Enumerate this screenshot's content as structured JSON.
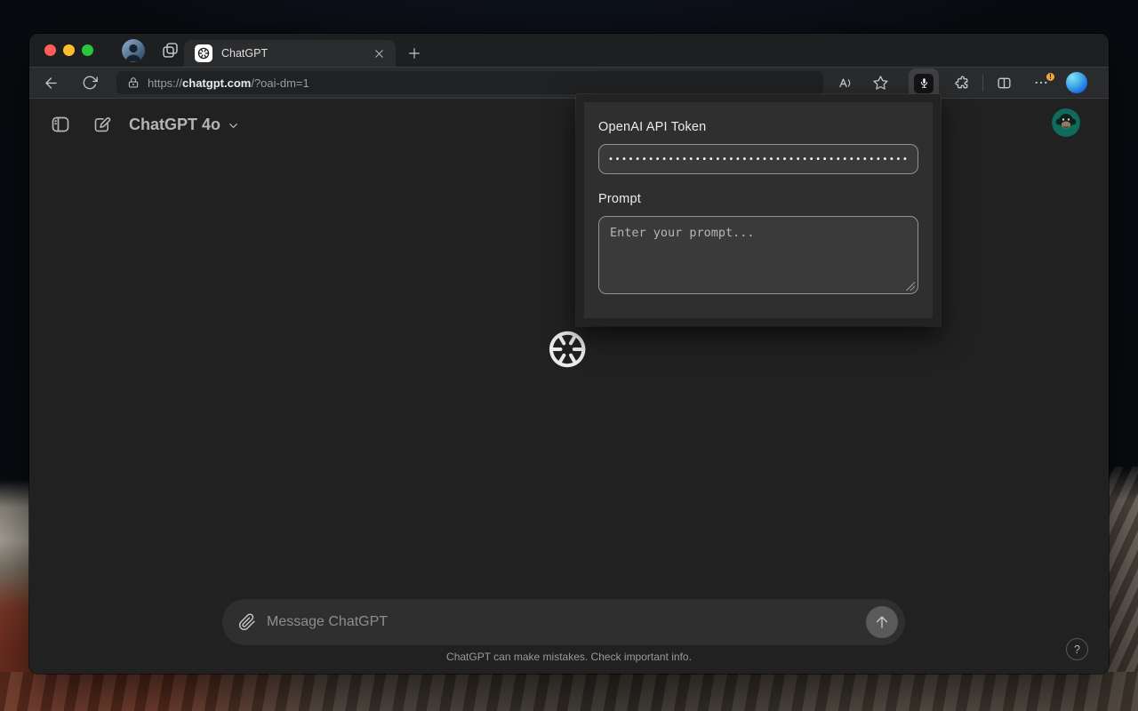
{
  "browser": {
    "tab_title": "ChatGPT",
    "url": {
      "scheme": "https://",
      "host": "chatgpt.com",
      "path": "/?oai-dm=1"
    }
  },
  "extension_popup": {
    "token_label": "OpenAI API Token",
    "token_value": "••••••••••••••••••••••••••••••••••••••••••••••••••",
    "prompt_label": "Prompt",
    "prompt_placeholder": "Enter your prompt..."
  },
  "chat": {
    "model_label": "ChatGPT 4o",
    "composer_placeholder": "Message ChatGPT",
    "disclaimer": "ChatGPT can make mistakes. Check important info.",
    "help_label": "?"
  },
  "colors": {
    "accent_warning_badge": "#efa73e",
    "traffic_red": "#ff5f57",
    "traffic_yellow": "#febc2e",
    "traffic_green": "#29c73f",
    "page_bg": "#212121",
    "chrome_bg": "#1e1f20",
    "navbar_bg": "#2a2b2c",
    "popup_bg": "#2f2f30"
  }
}
